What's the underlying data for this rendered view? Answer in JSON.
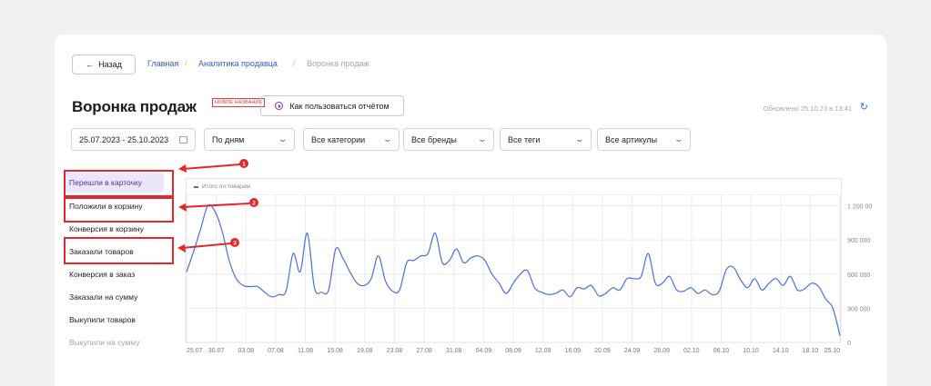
{
  "breadcrumb": {
    "back_label": "Назад",
    "back_arrow": "←",
    "home": "Главная",
    "section": "Аналитика продавца",
    "current": "Воронка продаж",
    "separator": "/"
  },
  "header": {
    "title": "Воронка продаж",
    "badge": "НОВОЕ НАЗВАНИЕ",
    "howto_label": "Как пользоваться отчётом",
    "updated_text": "Обновлено 25.10.23 в 13:41",
    "refresh_icon": "↻"
  },
  "filters": {
    "date_range": "25.07.2023 - 25.10.2023",
    "period": "По дням",
    "categories": "Все категории",
    "brands": "Все бренды",
    "tags": "Все теги",
    "articles": "Все артикулы",
    "chevron": "⌄"
  },
  "metrics": [
    {
      "label": "Перешли в карточку"
    },
    {
      "label": "Положили в корзину"
    },
    {
      "label": "Конверсия в корзину"
    },
    {
      "label": "Заказали товаров"
    },
    {
      "label": "Конверсия в заказ"
    },
    {
      "label": "Заказали на сумму"
    },
    {
      "label": "Выкупили товаров"
    },
    {
      "label": "Выкупили на сумму"
    }
  ],
  "annotations": [
    "1",
    "2",
    "3"
  ],
  "colors": {
    "line": "#4a6ee0",
    "accent_red": "#e5262b",
    "active_bg": "#ece6fa"
  },
  "chart_data": {
    "type": "line",
    "legend": "Итого по товарам",
    "y_ticks": [
      "0",
      "300 000",
      "600 000",
      "900 000",
      "1 200 00"
    ],
    "ylim": [
      0,
      1300000
    ],
    "x_ticks": [
      "25.07",
      "30.07",
      "03.08",
      "07.08",
      "11.08",
      "15.08",
      "19.08",
      "23.08",
      "27.08",
      "31.08",
      "04.09",
      "08.09",
      "12.09",
      "16.09",
      "20.09",
      "24.09",
      "28.09",
      "02.10",
      "06.10",
      "10.10",
      "14.10",
      "18.10",
      "25.10"
    ],
    "series": [
      {
        "name": "Итого по товарам",
        "x_days": [
          0,
          1,
          2,
          3,
          4,
          5,
          6,
          7,
          8,
          9,
          10,
          11,
          12,
          13,
          14,
          15,
          16,
          17,
          18,
          19,
          20,
          21,
          22,
          23,
          24,
          25,
          26,
          27,
          28,
          29,
          30,
          31,
          32,
          33,
          34,
          35,
          36,
          37,
          38,
          39,
          40,
          41,
          42,
          43,
          44,
          45,
          46,
          47,
          48,
          49,
          50,
          51,
          52,
          53,
          54,
          55,
          56,
          57,
          58,
          59,
          60,
          61,
          62,
          63,
          64,
          65,
          66,
          67,
          68,
          69,
          70,
          71,
          72,
          73,
          74,
          75,
          76,
          77,
          78,
          79,
          80,
          81,
          82,
          83,
          84,
          85,
          86,
          87,
          88,
          89,
          90,
          91,
          92
        ],
        "values": [
          620000,
          800000,
          1000000,
          1200000,
          1150000,
          980000,
          720000,
          560000,
          500000,
          490000,
          490000,
          440000,
          400000,
          420000,
          450000,
          780000,
          620000,
          960000,
          480000,
          440000,
          460000,
          820000,
          740000,
          620000,
          520000,
          500000,
          560000,
          760000,
          540000,
          450000,
          460000,
          700000,
          720000,
          760000,
          780000,
          960000,
          700000,
          720000,
          820000,
          700000,
          740000,
          760000,
          720000,
          600000,
          520000,
          430000,
          520000,
          600000,
          630000,
          480000,
          440000,
          420000,
          430000,
          460000,
          400000,
          480000,
          470000,
          500000,
          410000,
          430000,
          480000,
          460000,
          560000,
          560000,
          580000,
          780000,
          520000,
          520000,
          580000,
          460000,
          450000,
          480000,
          430000,
          460000,
          420000,
          450000,
          640000,
          660000,
          550000,
          480000,
          560000,
          460000,
          520000,
          560000,
          500000,
          580000,
          460000,
          470000,
          520000,
          490000,
          380000,
          300000,
          60000
        ]
      }
    ]
  }
}
